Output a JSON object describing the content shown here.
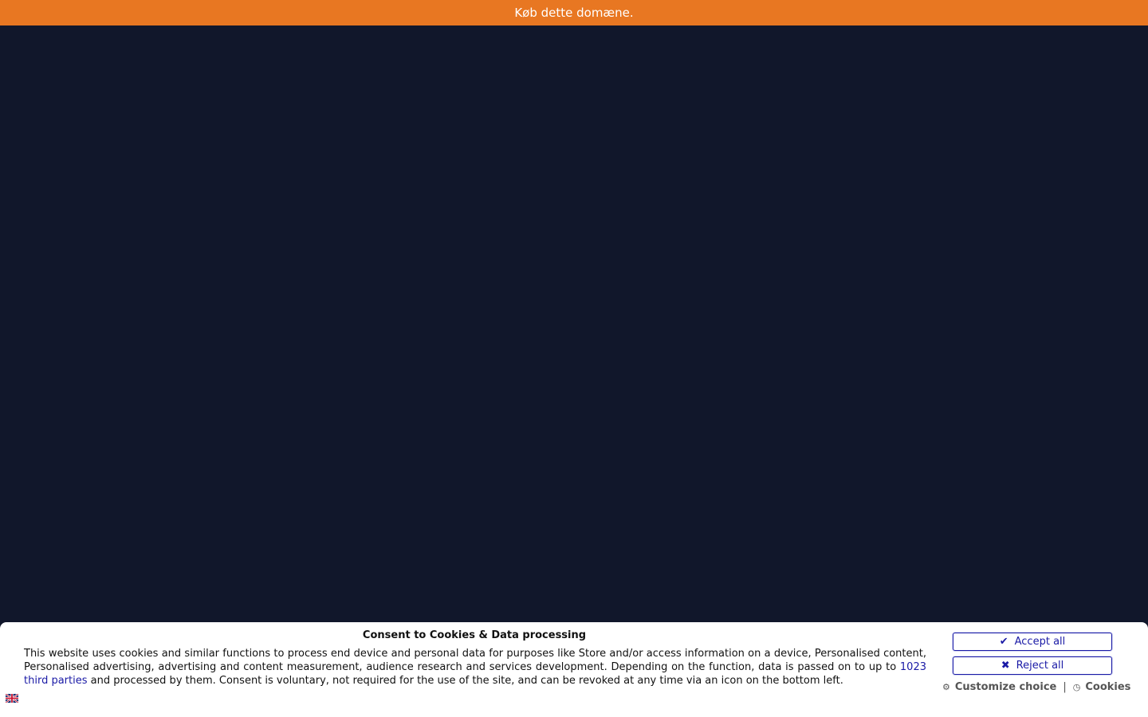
{
  "banner": {
    "text": "Køb dette domæne.",
    "color": "#e87722"
  },
  "background_color": "#11172b",
  "consent": {
    "title": "Consent to Cookies & Data processing",
    "text_before": "This website uses cookies and similar functions to process end device and personal data for purposes like Store and/or access information on a device, Personalised content, Personalised advertising, advertising and content measurement, audience research and services development. Depending on the function, data is passed on to up to ",
    "third_parties_link": "1023 third parties",
    "text_after": " and processed by them. Consent is voluntary, not required for the use of the site, and can be revoked at any time via an icon on the bottom left.",
    "accept_label": "Accept all",
    "reject_label": "Reject all",
    "customize_label": "Customize choice",
    "separator": "|",
    "cookies_label": "Cookies",
    "language_icon": "uk-flag-icon"
  }
}
